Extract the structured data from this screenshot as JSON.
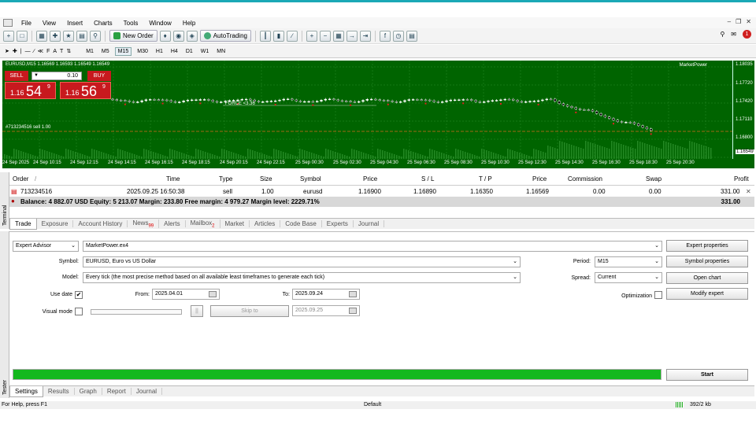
{
  "menu": [
    "File",
    "View",
    "Insert",
    "Charts",
    "Tools",
    "Window",
    "Help"
  ],
  "toolbar": {
    "new_order": "New Order",
    "autotrading": "AutoTrading",
    "notifications": "1"
  },
  "timeframes": [
    "M1",
    "M5",
    "M15",
    "M30",
    "H1",
    "H4",
    "D1",
    "W1",
    "MN"
  ],
  "active_timeframe": "M15",
  "chart": {
    "title": "EURUSD,M15  1.16569 1.16593 1.16549 1.16549",
    "ea_name": "MarketPower",
    "sell_label": "SELL",
    "buy_label": "BUY",
    "lot": "0.10",
    "sell_small": "1.16",
    "sell_big": "54",
    "sell_sup": "9",
    "buy_small": "1.16",
    "buy_big": "56",
    "buy_sup": "9",
    "force_label": "FORCE <3.36",
    "order_label": "#713234516 sell 1.00",
    "current_price": "1.16549",
    "bg_color": "#006400",
    "y_labels": [
      "1.18035",
      "1.17720",
      "1.17420",
      "1.17110",
      "1.16800",
      "1.16549"
    ],
    "x_labels": [
      "24 Sep 2025",
      "24 Sep 10:15",
      "24 Sep 12:15",
      "24 Sep 14:15",
      "24 Sep 16:15",
      "24 Sep 18:15",
      "24 Sep 20:15",
      "24 Sep 22:15",
      "25 Sep 00:30",
      "25 Sep 02:30",
      "25 Sep 04:30",
      "25 Sep 06:30",
      "25 Sep 08:30",
      "25 Sep 10:30",
      "25 Sep 12:30",
      "25 Sep 14:30",
      "25 Sep 16:30",
      "25 Sep 18:30",
      "25 Sep 20:30"
    ]
  },
  "terminal": {
    "side_label": "Terminal",
    "columns": [
      "Order",
      "Time",
      "Type",
      "Size",
      "Symbol",
      "Price",
      "S / L",
      "T / P",
      "Price",
      "Commission",
      "Swap",
      "Profit"
    ],
    "sort_mark": "/",
    "row": {
      "order": "713234516",
      "time": "2025.09.25 16:50:38",
      "type": "sell",
      "size": "1.00",
      "symbol": "eurusd",
      "price": "1.16900",
      "sl": "1.16890",
      "tp": "1.16350",
      "cur_price": "1.16569",
      "commission": "0.00",
      "swap": "0.00",
      "profit": "331.00"
    },
    "balance_text": "Balance: 4 882.07 USD  Equity: 5 213.07  Margin: 233.80  Free margin: 4 979.27  Margin level: 2229.71%",
    "balance_profit": "331.00",
    "tabs": [
      {
        "label": "Trade",
        "badge": ""
      },
      {
        "label": "Exposure",
        "badge": ""
      },
      {
        "label": "Account History",
        "badge": ""
      },
      {
        "label": "News",
        "badge": "99"
      },
      {
        "label": "Alerts",
        "badge": ""
      },
      {
        "label": "Mailbox",
        "badge": "2"
      },
      {
        "label": "Market",
        "badge": ""
      },
      {
        "label": "Articles",
        "badge": ""
      },
      {
        "label": "Code Base",
        "badge": ""
      },
      {
        "label": "Experts",
        "badge": ""
      },
      {
        "label": "Journal",
        "badge": ""
      }
    ]
  },
  "tester": {
    "side_label": "Tester",
    "type_select": "Expert Advisor",
    "ea_file": "MarketPower.ex4",
    "symbol_label": "Symbol:",
    "symbol_value": "EURUSD, Euro vs US Dollar",
    "model_label": "Model:",
    "model_value": "Every tick (the most precise method based on all available least timeframes to generate each tick)",
    "use_date_label": "Use date",
    "use_date_checked": "✔",
    "from_label": "From:",
    "from_value": "2025.04.01",
    "to_label": "To:",
    "to_value": "2025.09.24",
    "visual_mode_label": "Visual mode",
    "pause_label": "||",
    "skip_to_label": "Skip to",
    "skip_date": "2025.09.25",
    "period_label": "Period:",
    "period_value": "M15",
    "spread_label": "Spread:",
    "spread_value": "Current",
    "optimization_label": "Optimization",
    "expert_properties": "Expert properties",
    "symbol_properties": "Symbol properties",
    "open_chart": "Open chart",
    "modify_expert": "Modify expert",
    "start": "Start",
    "progress": 100,
    "progress_color": "#14b81e",
    "tabs": [
      "Settings",
      "Results",
      "Graph",
      "Report",
      "Journal"
    ]
  },
  "status": {
    "help": "For Help, press F1",
    "profile": "Default",
    "traffic": "392/2 kb"
  }
}
